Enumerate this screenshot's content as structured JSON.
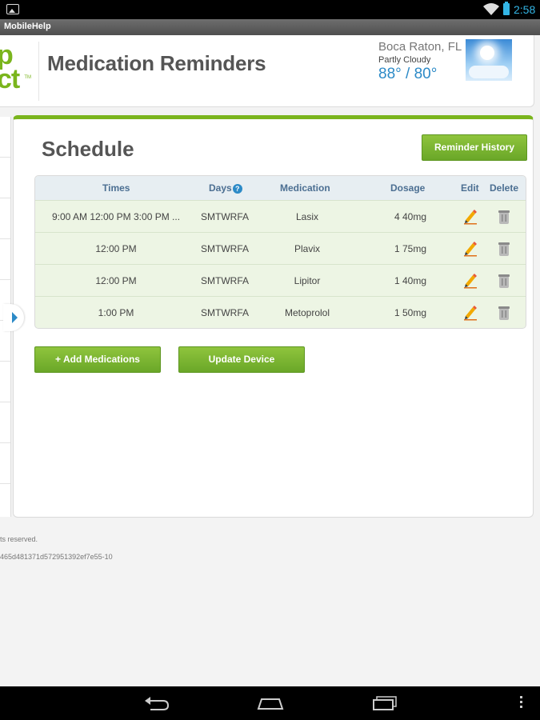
{
  "status_bar": {
    "time": "2:58"
  },
  "app_bar": {
    "title": "MobileHelp"
  },
  "header": {
    "logo_line1": "p",
    "logo_line2": "ct",
    "logo_tm": "TM",
    "title": "Medication Reminders",
    "weather": {
      "city": "Boca Raton, FL",
      "condition": "Partly Cloudy",
      "temps": "88° / 80°"
    }
  },
  "schedule": {
    "title": "Schedule",
    "history_button": "Reminder History",
    "columns": {
      "times": "Times",
      "days": "Days",
      "medication": "Medication",
      "dosage": "Dosage",
      "edit": "Edit",
      "delete": "Delete"
    },
    "help_glyph": "?",
    "rows": [
      {
        "times": "9:00 AM 12:00 PM 3:00 PM ...",
        "days": "SMTWRFA",
        "medication": "Lasix",
        "dosage": "4 40mg"
      },
      {
        "times": "12:00 PM",
        "days": "SMTWRFA",
        "medication": "Plavix",
        "dosage": "1 75mg"
      },
      {
        "times": "12:00 PM",
        "days": "SMTWRFA",
        "medication": "Lipitor",
        "dosage": "1 40mg"
      },
      {
        "times": "1:00 PM",
        "days": "SMTWRFA",
        "medication": "Metoprolol",
        "dosage": "1 50mg"
      }
    ],
    "add_button": "+ Add Medications",
    "update_button": "Update Device"
  },
  "footer": {
    "line1": "ts reserved.",
    "line2": "465d481371d572951392ef7e55-10"
  },
  "colors": {
    "accent_green": "#7ab51d",
    "link_blue": "#2c8ac7",
    "header_text": "#4c6f92"
  }
}
